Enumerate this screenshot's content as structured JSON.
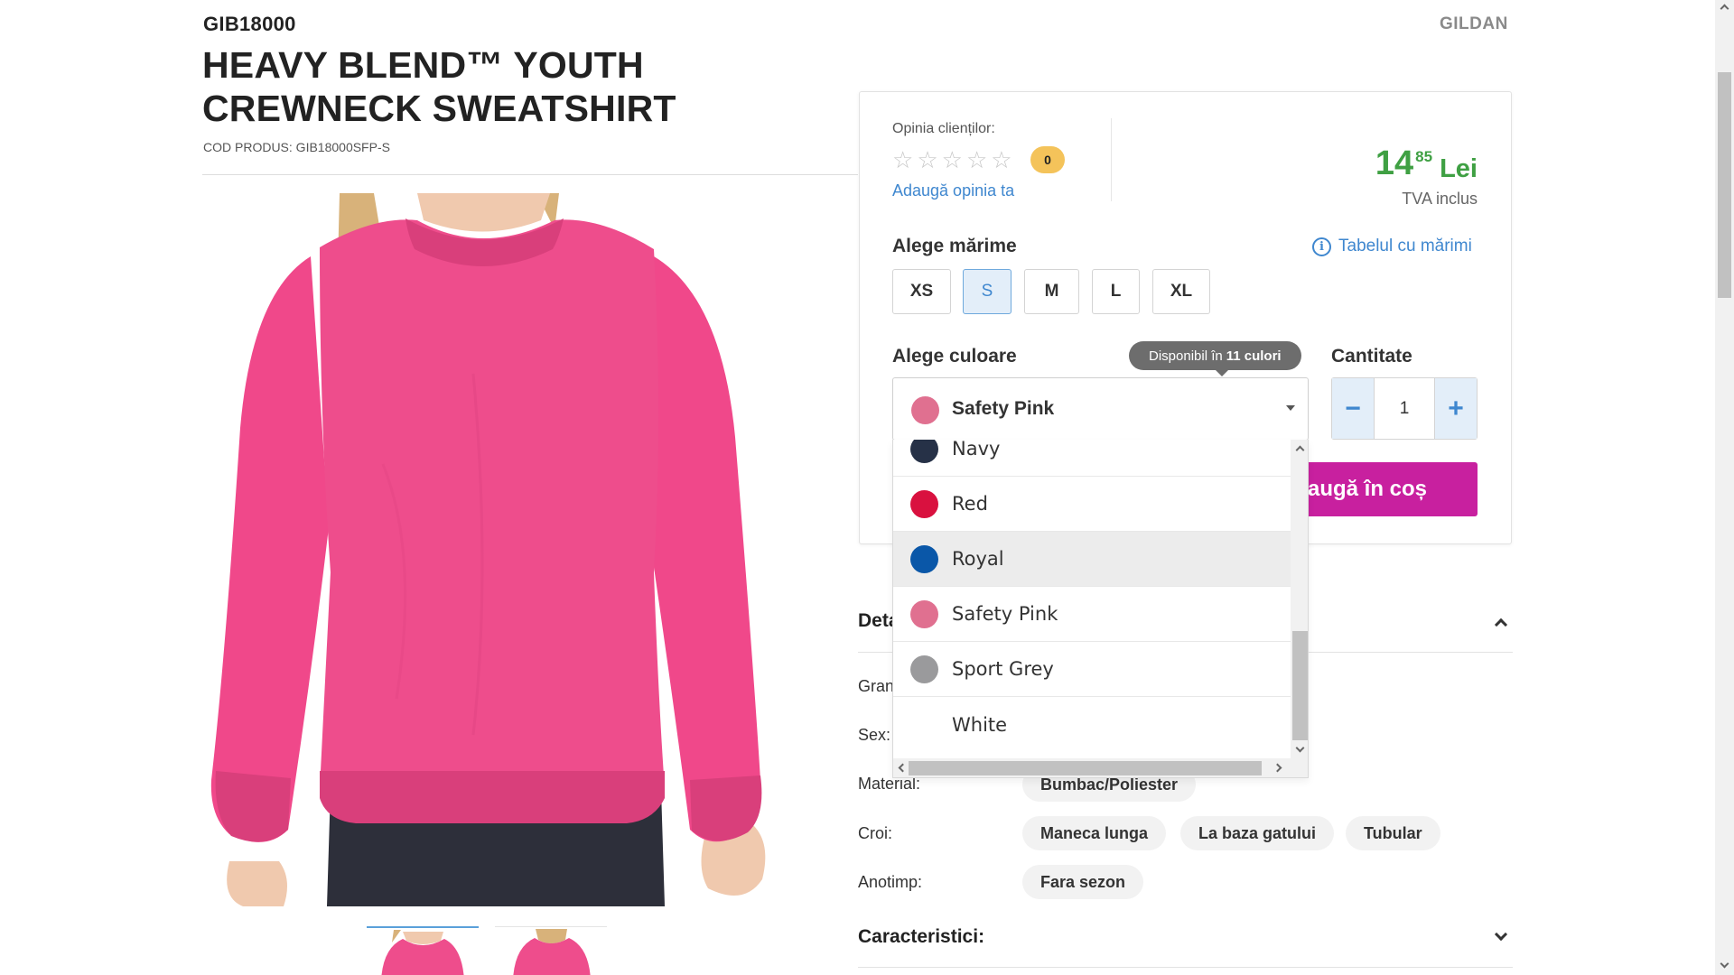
{
  "header": {
    "sku": "GIB18000",
    "brand": "GILDAN",
    "title": "HEAVY BLEND™ YOUTH CREWNECK SWEATSHIRT",
    "product_code": "COD PRODUS: GIB18000SFP-S"
  },
  "gallery": {
    "main_image": {
      "description_icon": "pink-sweatshirt-photo",
      "garment_color": "#f0488a"
    },
    "thumbnails": [
      {
        "icon": "pink-sweatshirt-thumbnail",
        "active": true
      },
      {
        "icon": "pink-sweatshirt-thumbnail",
        "active": false
      }
    ]
  },
  "reviews": {
    "label": "Opinia clienților:",
    "stars": [
      "☆",
      "☆",
      "☆",
      "☆",
      "☆"
    ],
    "rating_out_of_5": 0,
    "count": "0",
    "add_review_link": "Adaugă opinia ta"
  },
  "price": {
    "integer": "14",
    "decimals": "85",
    "currency": "Lei",
    "vat_note": "TVA inclus",
    "color": "#3fa043"
  },
  "size": {
    "label": "Alege mărime",
    "chart_link": "Tabelul cu mărimi",
    "info_icon": "i",
    "options": [
      "XS",
      "S",
      "M",
      "L",
      "XL"
    ],
    "selected": "S"
  },
  "color": {
    "label": "Alege culoare",
    "tooltip_prefix": "Disponibil în",
    "tooltip_count": "11 culori",
    "selected": {
      "name": "Safety Pink",
      "hex": "#e07090"
    },
    "dropdown_visible": [
      {
        "name": "Navy",
        "hex": "#263147"
      },
      {
        "name": "Red",
        "hex": "#d9113f"
      },
      {
        "name": "Royal",
        "hex": "#0a57a8",
        "highlighted": true
      },
      {
        "name": "Safety Pink",
        "hex": "#e07090"
      },
      {
        "name": "Sport Grey",
        "hex": "#9a9a9c"
      },
      {
        "name": "White",
        "hex": "#ffffff"
      }
    ]
  },
  "quantity": {
    "label": "Cantitate",
    "minus": "−",
    "plus": "+",
    "value": "1"
  },
  "cart": {
    "button_label": "Adaugă în coș",
    "visible_label": "laugă în coș",
    "color": "#c8209f"
  },
  "details": {
    "title": "Detalii produs",
    "visible_title": "Deta",
    "rows": [
      {
        "label": "Gran",
        "chips": []
      },
      {
        "label": "Sex:",
        "chips": []
      },
      {
        "label": "Material:",
        "chips": [
          "Bumbac/Poliester"
        ]
      },
      {
        "label": "Croi:",
        "chips": [
          "Maneca lunga",
          "La baza gatului",
          "Tubular"
        ]
      },
      {
        "label": "Anotimp:",
        "chips": [
          "Fara sezon"
        ]
      }
    ]
  },
  "characteristics": {
    "title": "Caracteristici:"
  }
}
